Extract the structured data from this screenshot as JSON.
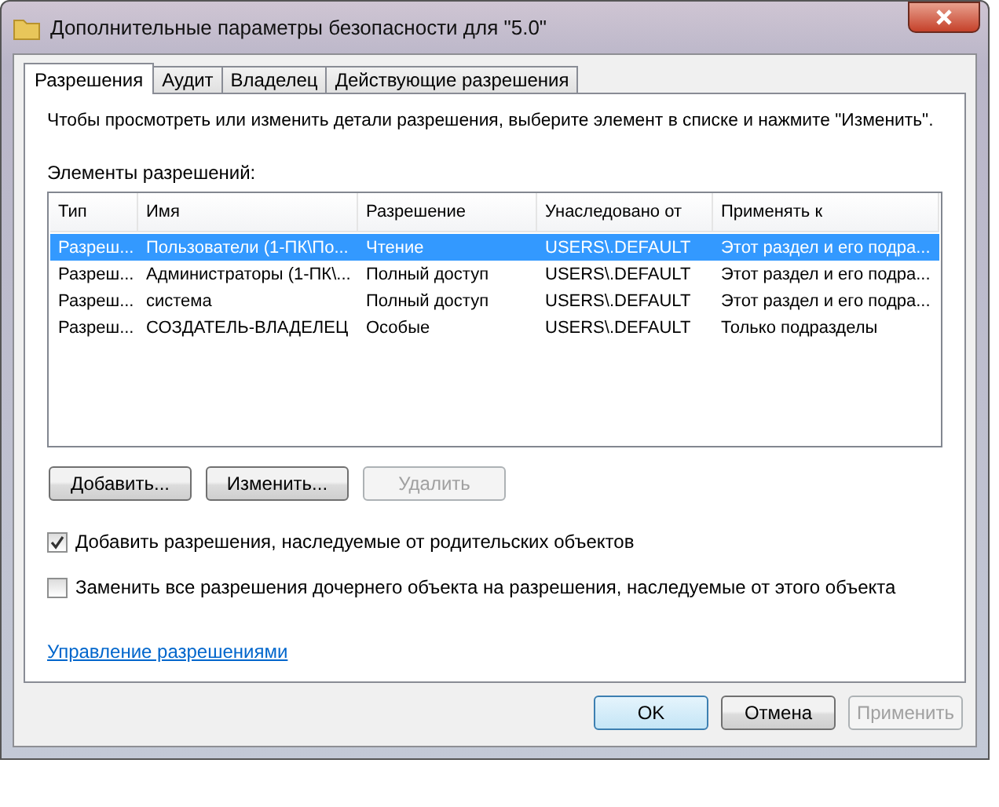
{
  "window": {
    "title": "Дополнительные параметры безопасности  для \"5.0\""
  },
  "tabs": [
    {
      "label": "Разрешения",
      "selected": true
    },
    {
      "label": "Аудит",
      "selected": false
    },
    {
      "label": "Владелец",
      "selected": false
    },
    {
      "label": "Действующие разрешения",
      "selected": false
    }
  ],
  "instruction": "Чтобы просмотреть или изменить детали разрешения, выберите элемент в списке и нажмите \"Изменить\".",
  "list_label": "Элементы разрешений:",
  "table": {
    "columns": [
      "Тип",
      "Имя",
      "Разрешение",
      "Унаследовано от",
      "Применять к"
    ],
    "rows": [
      {
        "selected": true,
        "cells": [
          "Разреш...",
          "Пользователи (1-ПК\\По...",
          "Чтение",
          "USERS\\.DEFAULT",
          "Этот раздел и его подра..."
        ]
      },
      {
        "selected": false,
        "cells": [
          "Разреш...",
          "Администраторы (1-ПК\\...",
          "Полный доступ",
          "USERS\\.DEFAULT",
          "Этот раздел и его подра..."
        ]
      },
      {
        "selected": false,
        "cells": [
          "Разреш...",
          "система",
          "Полный доступ",
          "USERS\\.DEFAULT",
          "Этот раздел и его подра..."
        ]
      },
      {
        "selected": false,
        "cells": [
          "Разреш...",
          "СОЗДАТЕЛЬ-ВЛАДЕЛЕЦ",
          "Особые",
          "USERS\\.DEFAULT",
          "Только подразделы"
        ]
      }
    ]
  },
  "list_buttons": [
    {
      "label": "Добавить...",
      "disabled": false
    },
    {
      "label": "Изменить...",
      "disabled": false
    },
    {
      "label": "Удалить",
      "disabled": true
    }
  ],
  "checkboxes": [
    {
      "label": "Добавить разрешения, наследуемые от родительских объектов",
      "checked": true
    },
    {
      "label": "Заменить все разрешения дочернего объекта на разрешения, наследуемые от этого объекта",
      "checked": false
    }
  ],
  "link": "Управление разрешениями",
  "footer_buttons": [
    {
      "label": "OK",
      "disabled": false,
      "default": true
    },
    {
      "label": "Отмена",
      "disabled": false,
      "default": false
    },
    {
      "label": "Применить",
      "disabled": true,
      "default": false
    }
  ]
}
